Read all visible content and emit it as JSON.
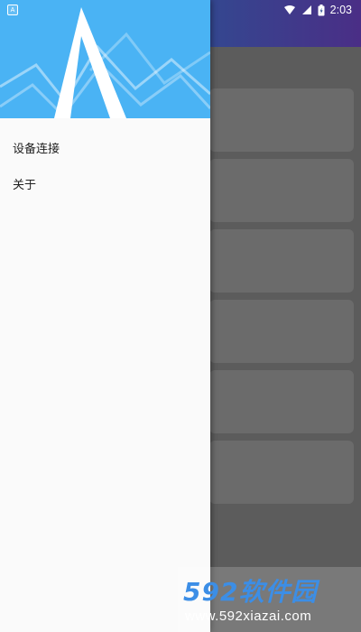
{
  "status_bar": {
    "time": "2:03",
    "notification_icon": "app-notification-icon",
    "wifi_icon": "wifi-icon",
    "signal_icon": "cell-signal-icon",
    "battery_icon": "battery-icon",
    "notification_badge": "A"
  },
  "drawer": {
    "header_logo": "app-logo-triangle",
    "menu": [
      {
        "label": "设备连接"
      },
      {
        "label": "关于"
      }
    ]
  },
  "watermark": {
    "brand": "592软件园",
    "url": "www.592xiazai.com"
  },
  "colors": {
    "appbar_start": "#1f6aa3",
    "appbar_end": "#4a2e86",
    "drawer_header": "#4ab3f4",
    "scrim": "#5c5c5c",
    "card": "#6b6b6b",
    "drawer_bg": "#fafafa"
  }
}
